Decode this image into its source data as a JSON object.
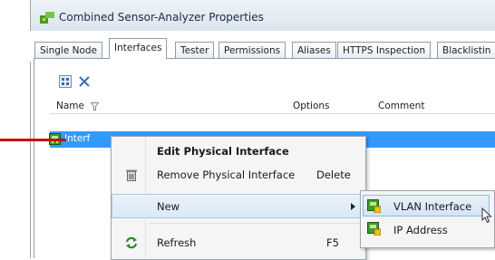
{
  "window": {
    "title": "Combined Sensor-Analyzer Properties"
  },
  "tabs": [
    {
      "label": "Single Node"
    },
    {
      "label": "Interfaces"
    },
    {
      "label": "Tester"
    },
    {
      "label": "Permissions"
    },
    {
      "label": "Aliases"
    },
    {
      "label": "HTTPS Inspection"
    },
    {
      "label": "Blacklistin"
    }
  ],
  "toolbar": {
    "expand_icon": "expand-all-icon",
    "collapse_icon": "collapse-all-icon"
  },
  "columns": {
    "name": "Name",
    "options": "Options",
    "comment": "Comment"
  },
  "row": {
    "label": "Interf"
  },
  "context_menu": {
    "edit": "Edit Physical Interface",
    "remove": "Remove Physical Interface",
    "remove_shortcut": "Delete",
    "new": "New",
    "refresh": "Refresh",
    "refresh_shortcut": "F5"
  },
  "submenu": {
    "vlan": "VLAN Interface",
    "ip": "IP Address"
  },
  "colors": {
    "selection": "#3399ff",
    "pointer_line": "#cc0000",
    "menu_bg": "#f5f5f5"
  }
}
